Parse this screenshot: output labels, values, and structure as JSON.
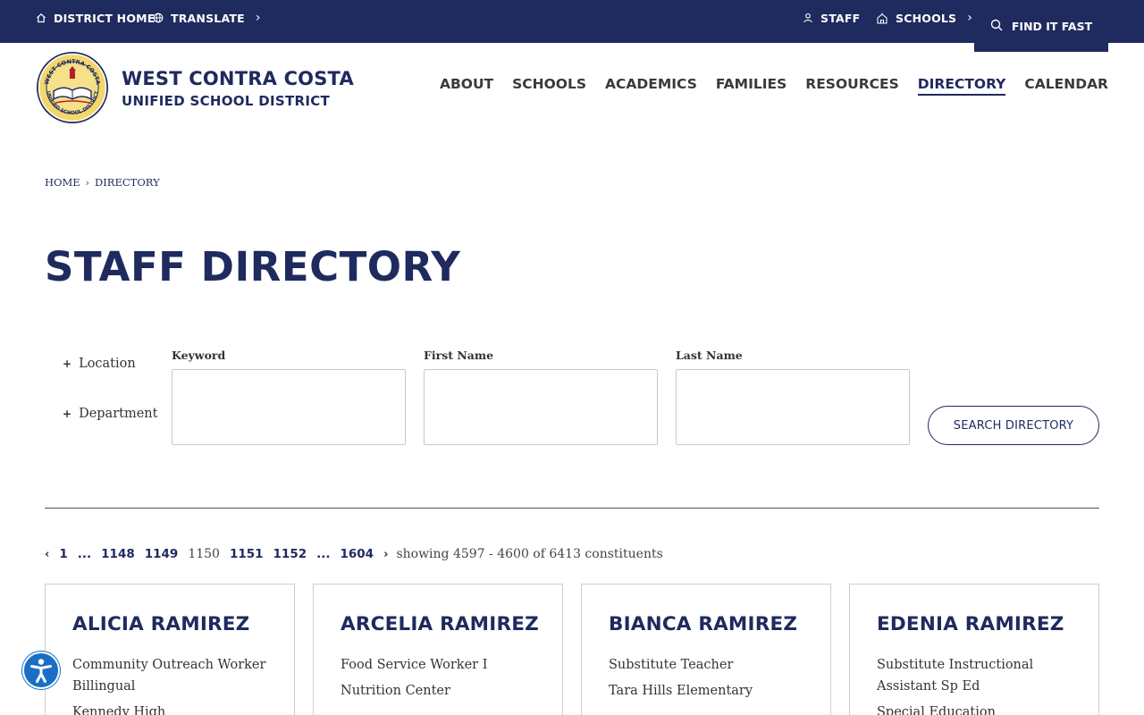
{
  "utility_nav": {
    "district_home": "DISTRICT HOME",
    "translate": "TRANSLATE",
    "staff": "STAFF",
    "schools": "SCHOOLS",
    "find_it_fast": "FIND IT FAST"
  },
  "brand": {
    "line1": "WEST CONTRA COSTA",
    "line2": "UNIFIED SCHOOL DISTRICT",
    "seal_top_text": "WEST CONTRA COSTA",
    "seal_bottom_text": "UNIFIED SCHOOL DISTRICT"
  },
  "main_nav": [
    {
      "label": "ABOUT",
      "active": false
    },
    {
      "label": "SCHOOLS",
      "active": false
    },
    {
      "label": "ACADEMICS",
      "active": false
    },
    {
      "label": "FAMILIES",
      "active": false
    },
    {
      "label": "RESOURCES",
      "active": false
    },
    {
      "label": "DIRECTORY",
      "active": true
    },
    {
      "label": "CALENDAR",
      "active": false
    }
  ],
  "breadcrumb": {
    "home": "HOME",
    "separator": "›",
    "current": "DIRECTORY"
  },
  "page_title": "STAFF DIRECTORY",
  "filters": {
    "location": "Location",
    "department": "Department",
    "keyword_label": "Keyword",
    "keyword_value": "",
    "first_name_label": "First Name",
    "first_name_value": "",
    "last_name_label": "Last Name",
    "last_name_value": "",
    "search_button": "SEARCH DIRECTORY"
  },
  "pagination": {
    "prev": "‹",
    "first": "1",
    "ellipsis": "...",
    "pages": [
      "1148",
      "1149",
      "1150",
      "1151",
      "1152"
    ],
    "current": "1150",
    "last": "1604",
    "next": "›",
    "showing": "showing 4597 - 4600 of 6413 constituents"
  },
  "staff": [
    {
      "name": "ALICIA RAMIREZ",
      "title": "Community Outreach Worker Billingual",
      "location": "Kennedy High"
    },
    {
      "name": "ARCELIA RAMIREZ",
      "title": "Food Service Worker I",
      "location": "Nutrition Center"
    },
    {
      "name": "BIANCA RAMIREZ",
      "title": "Substitute Teacher",
      "location": "Tara Hills Elementary"
    },
    {
      "name": "EDENIA RAMIREZ",
      "title": "Substitute Instructional Assistant Sp Ed",
      "location": "Special Education"
    }
  ],
  "colors": {
    "navy": "#1f2a5e",
    "accessibility_blue": "#1a6fc4"
  }
}
